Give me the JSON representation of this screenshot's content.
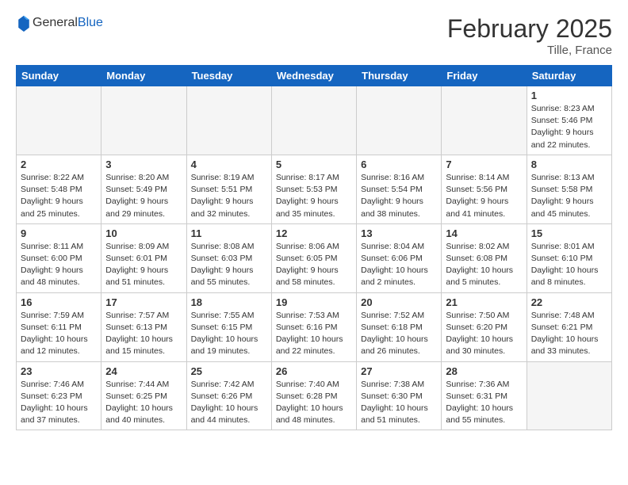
{
  "header": {
    "logo_general": "General",
    "logo_blue": "Blue",
    "month": "February 2025",
    "location": "Tille, France"
  },
  "days_of_week": [
    "Sunday",
    "Monday",
    "Tuesday",
    "Wednesday",
    "Thursday",
    "Friday",
    "Saturday"
  ],
  "weeks": [
    [
      {
        "day": "",
        "info": ""
      },
      {
        "day": "",
        "info": ""
      },
      {
        "day": "",
        "info": ""
      },
      {
        "day": "",
        "info": ""
      },
      {
        "day": "",
        "info": ""
      },
      {
        "day": "",
        "info": ""
      },
      {
        "day": "1",
        "info": "Sunrise: 8:23 AM\nSunset: 5:46 PM\nDaylight: 9 hours\nand 22 minutes."
      }
    ],
    [
      {
        "day": "2",
        "info": "Sunrise: 8:22 AM\nSunset: 5:48 PM\nDaylight: 9 hours\nand 25 minutes."
      },
      {
        "day": "3",
        "info": "Sunrise: 8:20 AM\nSunset: 5:49 PM\nDaylight: 9 hours\nand 29 minutes."
      },
      {
        "day": "4",
        "info": "Sunrise: 8:19 AM\nSunset: 5:51 PM\nDaylight: 9 hours\nand 32 minutes."
      },
      {
        "day": "5",
        "info": "Sunrise: 8:17 AM\nSunset: 5:53 PM\nDaylight: 9 hours\nand 35 minutes."
      },
      {
        "day": "6",
        "info": "Sunrise: 8:16 AM\nSunset: 5:54 PM\nDaylight: 9 hours\nand 38 minutes."
      },
      {
        "day": "7",
        "info": "Sunrise: 8:14 AM\nSunset: 5:56 PM\nDaylight: 9 hours\nand 41 minutes."
      },
      {
        "day": "8",
        "info": "Sunrise: 8:13 AM\nSunset: 5:58 PM\nDaylight: 9 hours\nand 45 minutes."
      }
    ],
    [
      {
        "day": "9",
        "info": "Sunrise: 8:11 AM\nSunset: 6:00 PM\nDaylight: 9 hours\nand 48 minutes."
      },
      {
        "day": "10",
        "info": "Sunrise: 8:09 AM\nSunset: 6:01 PM\nDaylight: 9 hours\nand 51 minutes."
      },
      {
        "day": "11",
        "info": "Sunrise: 8:08 AM\nSunset: 6:03 PM\nDaylight: 9 hours\nand 55 minutes."
      },
      {
        "day": "12",
        "info": "Sunrise: 8:06 AM\nSunset: 6:05 PM\nDaylight: 9 hours\nand 58 minutes."
      },
      {
        "day": "13",
        "info": "Sunrise: 8:04 AM\nSunset: 6:06 PM\nDaylight: 10 hours\nand 2 minutes."
      },
      {
        "day": "14",
        "info": "Sunrise: 8:02 AM\nSunset: 6:08 PM\nDaylight: 10 hours\nand 5 minutes."
      },
      {
        "day": "15",
        "info": "Sunrise: 8:01 AM\nSunset: 6:10 PM\nDaylight: 10 hours\nand 8 minutes."
      }
    ],
    [
      {
        "day": "16",
        "info": "Sunrise: 7:59 AM\nSunset: 6:11 PM\nDaylight: 10 hours\nand 12 minutes."
      },
      {
        "day": "17",
        "info": "Sunrise: 7:57 AM\nSunset: 6:13 PM\nDaylight: 10 hours\nand 15 minutes."
      },
      {
        "day": "18",
        "info": "Sunrise: 7:55 AM\nSunset: 6:15 PM\nDaylight: 10 hours\nand 19 minutes."
      },
      {
        "day": "19",
        "info": "Sunrise: 7:53 AM\nSunset: 6:16 PM\nDaylight: 10 hours\nand 22 minutes."
      },
      {
        "day": "20",
        "info": "Sunrise: 7:52 AM\nSunset: 6:18 PM\nDaylight: 10 hours\nand 26 minutes."
      },
      {
        "day": "21",
        "info": "Sunrise: 7:50 AM\nSunset: 6:20 PM\nDaylight: 10 hours\nand 30 minutes."
      },
      {
        "day": "22",
        "info": "Sunrise: 7:48 AM\nSunset: 6:21 PM\nDaylight: 10 hours\nand 33 minutes."
      }
    ],
    [
      {
        "day": "23",
        "info": "Sunrise: 7:46 AM\nSunset: 6:23 PM\nDaylight: 10 hours\nand 37 minutes."
      },
      {
        "day": "24",
        "info": "Sunrise: 7:44 AM\nSunset: 6:25 PM\nDaylight: 10 hours\nand 40 minutes."
      },
      {
        "day": "25",
        "info": "Sunrise: 7:42 AM\nSunset: 6:26 PM\nDaylight: 10 hours\nand 44 minutes."
      },
      {
        "day": "26",
        "info": "Sunrise: 7:40 AM\nSunset: 6:28 PM\nDaylight: 10 hours\nand 48 minutes."
      },
      {
        "day": "27",
        "info": "Sunrise: 7:38 AM\nSunset: 6:30 PM\nDaylight: 10 hours\nand 51 minutes."
      },
      {
        "day": "28",
        "info": "Sunrise: 7:36 AM\nSunset: 6:31 PM\nDaylight: 10 hours\nand 55 minutes."
      },
      {
        "day": "",
        "info": ""
      }
    ]
  ]
}
